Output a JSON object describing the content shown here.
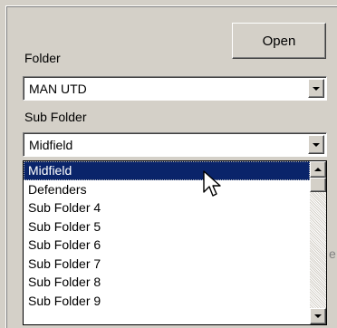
{
  "open_button": {
    "label": "Open"
  },
  "folder": {
    "label": "Folder",
    "value": "MAN UTD"
  },
  "sub_folder": {
    "label": "Sub Folder",
    "value": "Midfield"
  },
  "dropdown_list": {
    "items": [
      "Midfield",
      "Defenders",
      "Sub Folder  4",
      "Sub Folder  5",
      "Sub Folder  6",
      "Sub Folder  7",
      "Sub Folder  8",
      "Sub Folder  9"
    ],
    "selected_index": 0
  },
  "icons": {
    "dropdown_arrow": "chevron-down-icon",
    "scroll_up": "scroll-up-icon",
    "scroll_down": "scroll-down-icon",
    "cursor": "mouse-pointer-icon"
  },
  "colors": {
    "window_bg": "#d4d0c8",
    "selection_bg": "#0a246a",
    "selection_text": "#ffffff"
  }
}
